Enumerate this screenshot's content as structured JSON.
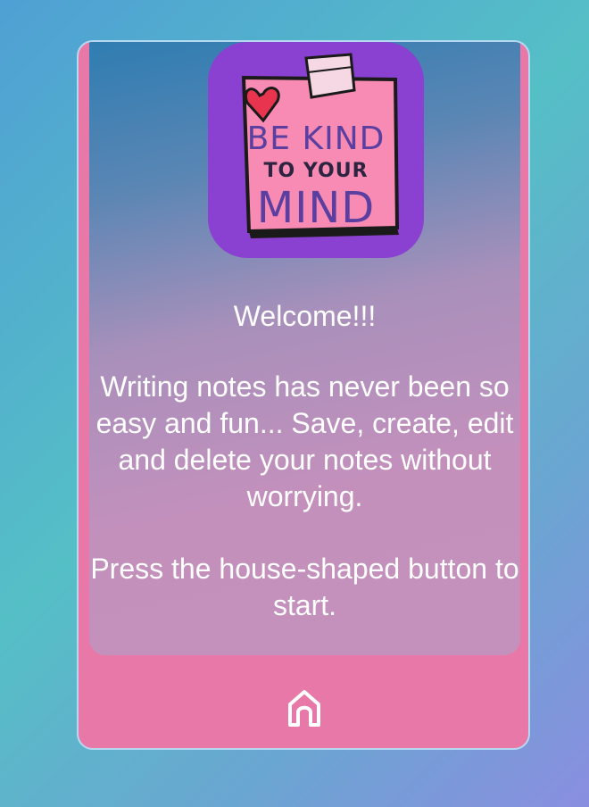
{
  "logo": {
    "line1": "BE KIND",
    "line2": "TO YOUR",
    "line3": "MIND"
  },
  "welcome": {
    "title": "Welcome!!!",
    "description": "Writing notes has never been so easy and fun... Save, create, edit and delete your notes without worrying.",
    "instruction": "Press the house-shaped button to start."
  },
  "footer": {
    "home_icon": "home-icon"
  },
  "colors": {
    "card_pink": "#e878a8",
    "logo_purple": "#8a40d0",
    "note_pink": "#f78bb3",
    "border": "#b6d9f2"
  }
}
